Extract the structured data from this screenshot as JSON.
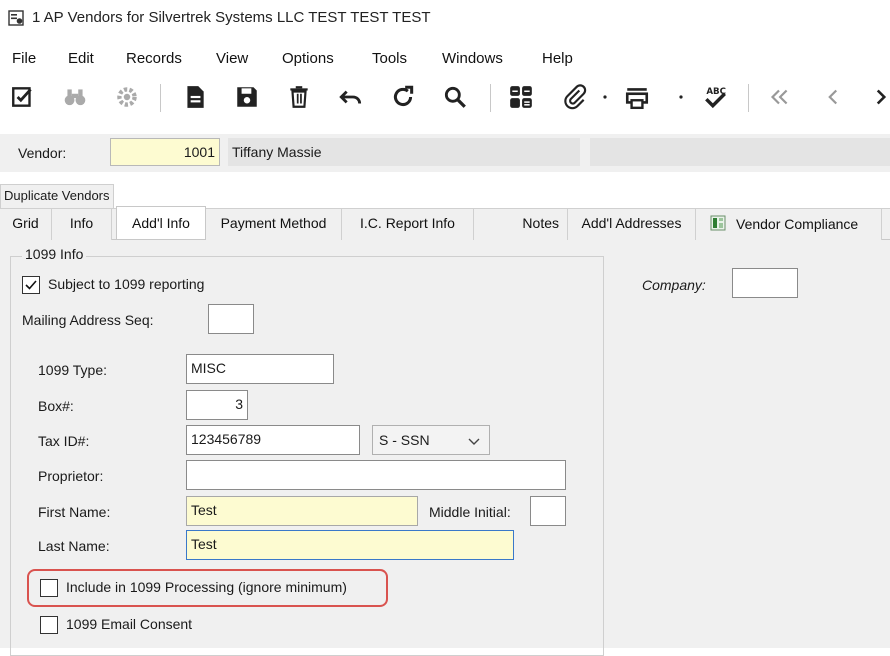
{
  "window": {
    "title": "1 AP Vendors for Silvertrek Systems LLC TEST TEST TEST"
  },
  "menu": [
    "File",
    "Edit",
    "Records",
    "View",
    "Options",
    "Tools",
    "Windows",
    "Help"
  ],
  "toolbar_icons": [
    "edit-check-icon",
    "binoculars-icon",
    "gear-icon",
    "new-document-icon",
    "save-icon",
    "delete-icon",
    "undo-icon",
    "refresh-icon",
    "search-icon",
    "calculator-icon",
    "attachment-icon",
    "print-icon",
    "spellcheck-icon",
    "first-record-icon",
    "previous-record-icon",
    "next-record-icon"
  ],
  "vendor": {
    "label": "Vendor:",
    "id": "1001",
    "name": "Tiffany Massie"
  },
  "duplicate_tab": "Duplicate Vendors",
  "tabs": [
    "Grid",
    "Info",
    "Add'l Info",
    "Payment Method",
    "I.C. Report Info",
    "Notes",
    "Add'l Addresses",
    "Vendor Compliance"
  ],
  "active_tab": "Add'l Info",
  "form": {
    "group_title": "1099 Info",
    "subject_1099": {
      "label": "Subject to 1099 reporting",
      "checked": true
    },
    "mailing_seq": {
      "label": "Mailing Address Seq:",
      "value": ""
    },
    "type": {
      "label": "1099 Type:",
      "value": "MISC"
    },
    "box": {
      "label": "Box#:",
      "value": "3"
    },
    "taxid": {
      "label": "Tax ID#:",
      "value": "123456789",
      "select": "S - SSN"
    },
    "proprietor": {
      "label": "Proprietor:",
      "value": ""
    },
    "first_name": {
      "label": "First Name:",
      "value": "Test"
    },
    "middle_initial": {
      "label": "Middle Initial:",
      "value": ""
    },
    "last_name": {
      "label": "Last Name:",
      "value": "Test"
    },
    "include_1099": {
      "label": "Include in 1099 Processing (ignore minimum)",
      "checked": false
    },
    "email_consent": {
      "label": "1099 Email Consent",
      "checked": false
    }
  },
  "company": {
    "label": "Company:",
    "value": ""
  },
  "colors": {
    "yellow_field": "#fdfbd1",
    "highlight": "#d9534f",
    "focus": "#3a78c9"
  }
}
